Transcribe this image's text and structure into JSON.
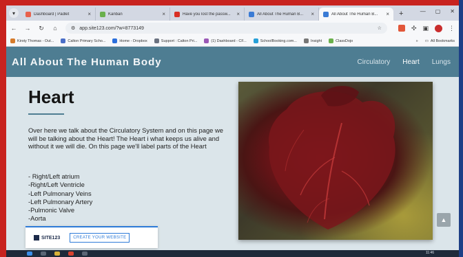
{
  "tabs": [
    {
      "title": "Dashboard | Padlet",
      "color": "#e8614c"
    },
    {
      "title": "Kanban",
      "color": "#6ab04c"
    },
    {
      "title": "Have you lost the passw...",
      "color": "#d93025"
    },
    {
      "title": "All About The Human B...",
      "color": "#3a7bd5"
    },
    {
      "title": "All About The Human B...",
      "color": "#3a7bd5",
      "active": true
    }
  ],
  "toolbar": {
    "url": "app.site123.com/?w=8773149"
  },
  "bookmarks": [
    {
      "label": "Kirsty Thomas - Out...",
      "color": "#d67b2b"
    },
    {
      "label": "Calton Primary Scho...",
      "color": "#4a6ec7"
    },
    {
      "label": "Home - Dropbox",
      "color": "#2b6fdc"
    },
    {
      "label": "Support : Calton Pri...",
      "color": "#6b7280"
    },
    {
      "label": "(1) Dashboard - CF...",
      "color": "#9b59b6"
    },
    {
      "label": "SchoolBooking.com...",
      "color": "#27a0d8"
    },
    {
      "label": "Insight",
      "color": "#777777"
    },
    {
      "label": "ClassDojo",
      "color": "#6ab04c"
    }
  ],
  "bookmarks_right": "All Bookmarks",
  "site": {
    "title": "All About The Human Body",
    "nav": [
      "Circulatory",
      "Heart",
      "Lungs"
    ]
  },
  "page": {
    "heading": "Heart",
    "paragraph": "Over here we talk about the Circulatory System and on this page we will be talking about the Heart! The Heart i what keeps us alive and without it we will die. On this page we'll label parts of the Heart",
    "list": [
      "- Right/Left atrium",
      "-Right/Left Ventricle",
      "-Left Pulmonary Veins",
      "-Left Pulmonary Artery",
      "-Pulmonic Valve",
      "-Aorta"
    ]
  },
  "promo": {
    "logo": "SITE123",
    "button": "CREATE YOUR WEBSITE"
  },
  "taskbar": {
    "clock": "11:46"
  },
  "colors": {
    "header": "#4e7d92",
    "content_bg": "#dbe5ea",
    "accent": "#2c7ad8"
  }
}
